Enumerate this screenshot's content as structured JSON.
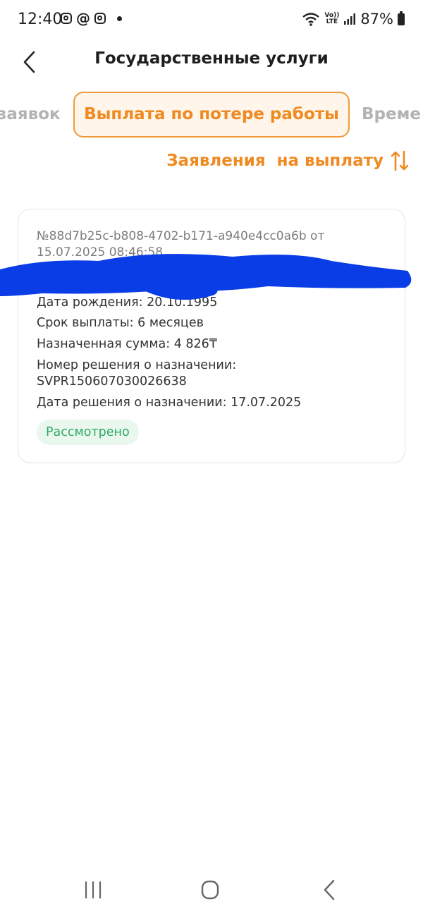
{
  "status_bar": {
    "time": "12:40",
    "volte_top": "Vo))",
    "volte_bottom": "LTE",
    "battery": "87%"
  },
  "header": {
    "title": "Государственные услуги",
    "back_icon": "chevron-left-icon"
  },
  "tabs": [
    {
      "label": "заявок",
      "active": false
    },
    {
      "label": "Выплата по потере работы",
      "active": true
    },
    {
      "label": "Време",
      "active": false
    }
  ],
  "sort": {
    "label": "Заявления  на выплату",
    "icon": "sort-arrows-icon"
  },
  "card": {
    "number": "№88d7b25c-b808-4702-b171-a940e4cc0a6b от 15.07.2025 08:46:58",
    "birth_date": "Дата рождения: 20.10.1995",
    "payment_term": "Срок выплаты: 6 месяцев",
    "assigned_amount": "Назначенная сумма: 4 826₸",
    "decision_number_label": "Номер решения о назначении:",
    "decision_number": "SVPR150607030026638",
    "decision_date": "Дата решения о назначении: 17.07.2025",
    "status": "Рассмотрено"
  },
  "colors": {
    "accent": "#ef8a21",
    "accent_bg": "#fff5ea",
    "status_green": "#2eaa62",
    "status_green_bg": "#eaf7ef",
    "redaction": "#0a3de6"
  }
}
